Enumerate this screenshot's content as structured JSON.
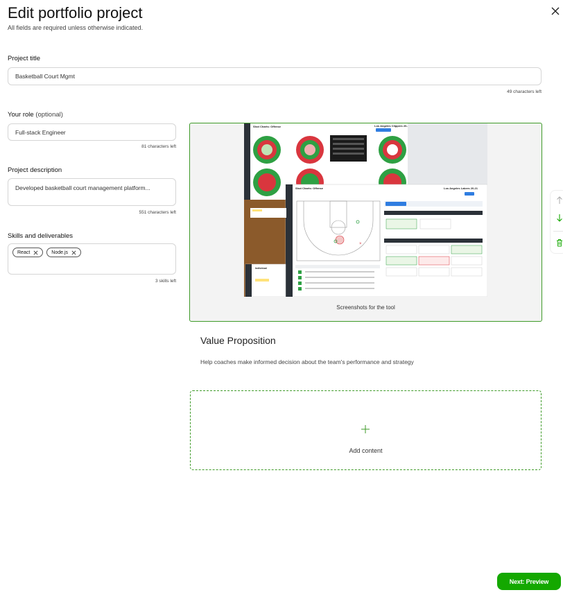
{
  "header": {
    "title": "Edit portfolio project",
    "subtitle": "All fields are required unless otherwise indicated."
  },
  "form": {
    "project_title": {
      "label": "Project title",
      "value": "Basketball Court Mgmt",
      "counter": "49 characters left"
    },
    "role": {
      "label": "Your role",
      "optional": "(optional)",
      "value": "Full-stack Engineer",
      "counter": "81 characters left"
    },
    "description": {
      "label": "Project description",
      "value": "Developed basketball court management platform...",
      "counter": "551 characters left"
    },
    "skills": {
      "label": "Skills and deliverables",
      "chips": [
        "React",
        "Node.js"
      ],
      "counter": "3 skills left"
    }
  },
  "content": {
    "screenshot_caption": "Screenshots for the tool",
    "screenshot_texts": {
      "back_title": "Shot Charts: Offense",
      "back_team": "Los Angeles Clippers 20-21",
      "front_title": "Shot Charts: Offense",
      "front_team": "Los Angeles Lakers 20-21",
      "individual": "Individual"
    },
    "value_title": "Value Proposition",
    "value_text": "Help coaches make informed decision about the team's performance and strategy",
    "add_content": "Add content"
  },
  "footer": {
    "next_label": "Next: Preview"
  },
  "colors": {
    "accent": "#14a800",
    "border_green": "#3d9a27"
  }
}
